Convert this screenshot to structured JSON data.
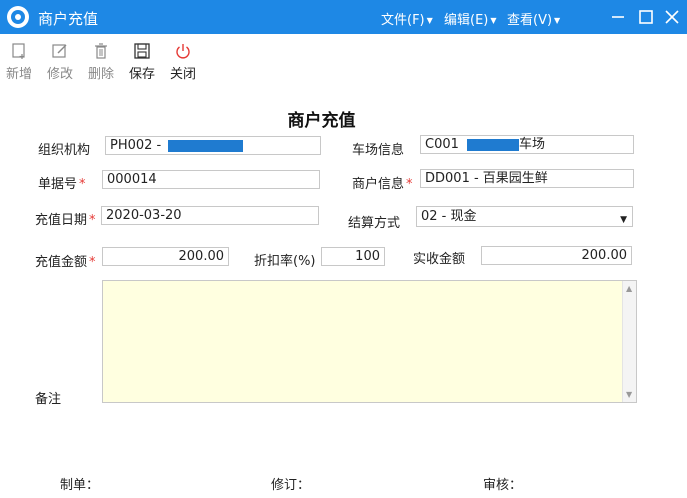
{
  "window": {
    "title": "商户充值",
    "menus": [
      "文件(F)",
      "编辑(E)",
      "查看(V)"
    ]
  },
  "toolbar": {
    "new": "新增",
    "edit": "修改",
    "delete": "删除",
    "save": "保存",
    "close": "关闭"
  },
  "form": {
    "title": "商户充值",
    "org": {
      "label": "组织机构",
      "value": "PH002 -"
    },
    "parking": {
      "label": "车场信息",
      "value_prefix": "C001",
      "value_suffix": "车场"
    },
    "doc_no": {
      "label": "单据号",
      "required_mark": "*",
      "value": "000014"
    },
    "merchant": {
      "label": "商户信息",
      "required_mark": "*",
      "value": "DD001 - 百果园生鲜"
    },
    "date": {
      "label": "充值日期",
      "required_mark": "*",
      "value": "2020-03-20"
    },
    "settle": {
      "label": "结算方式",
      "value": "02 - 现金"
    },
    "amount": {
      "label": "充值金额",
      "required_mark": "*",
      "value": "200.00"
    },
    "discount": {
      "label": "折扣率(%)",
      "value": "100"
    },
    "actual": {
      "label": "实收金额",
      "value": "200.00"
    },
    "notes": {
      "label": "备注",
      "value": ""
    }
  },
  "footer": {
    "maker": "制单：",
    "revise": "修订：",
    "audit": "审核："
  },
  "colors": {
    "titlebar": "#1e88e5",
    "notes_bg": "#ffffe0",
    "required": "#e53935"
  }
}
